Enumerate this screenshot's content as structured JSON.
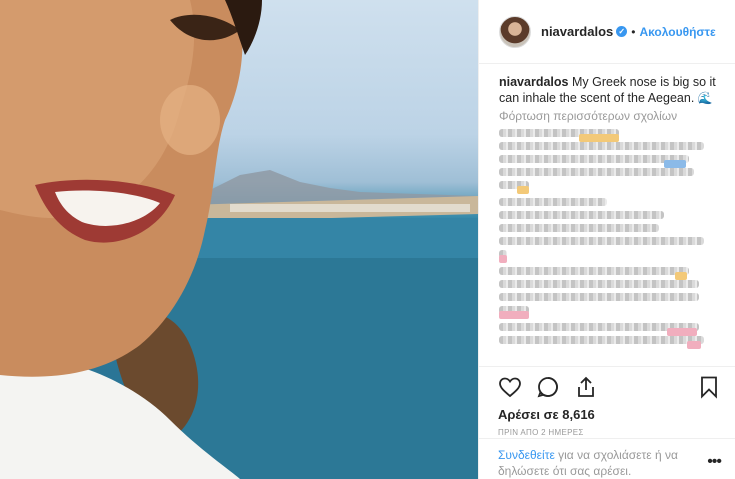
{
  "post": {
    "username": "niavardalos",
    "follow_label": "Ακολουθήστε",
    "separator": "•",
    "caption_user": "niavardalos",
    "caption_text": "My Greek nose is big so it can inhale the scent of the Aegean.",
    "load_more": "Φόρτωση περισσότερων σχολίων",
    "likes": "Αρέσει σε 8,616",
    "time": "ΠΡΙΝ ΑΠΟ 2 ΗΜΕΡΕΣ",
    "login_link": "Συνδεθείτε",
    "login_text": " για να σχολιάσετε ή να δηλώσετε ότι σας αρέσει.",
    "more_icon_text": "•••"
  },
  "colors": {
    "accent": "#3897f0",
    "muted": "#999999",
    "text": "#262626"
  },
  "icons": [
    "verified-badge-icon",
    "wave-emoji-icon",
    "heart-icon",
    "comment-icon",
    "share-icon",
    "bookmark-icon",
    "more-options-icon"
  ]
}
